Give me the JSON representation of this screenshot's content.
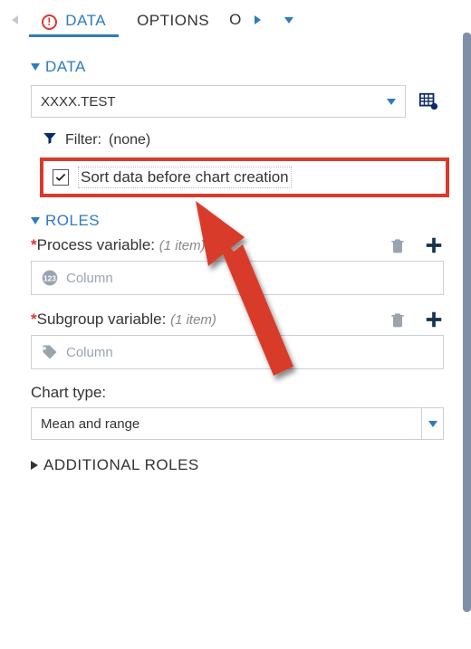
{
  "tabs": {
    "active": "DATA",
    "items": [
      "DATA",
      "OPTIONS"
    ],
    "overflow_letter": "O"
  },
  "data_section": {
    "title": "DATA",
    "source": "XXXX.TEST",
    "filter_label": "Filter:",
    "filter_value": "(none)",
    "sort_checkbox_label": "Sort data before chart creation",
    "sort_checked": true
  },
  "roles_section": {
    "title": "ROLES",
    "process_var": {
      "label": "Process variable:",
      "hint": "(1 item)",
      "placeholder": "Column"
    },
    "subgroup_var": {
      "label": "Subgroup variable:",
      "hint": "(1 item)",
      "placeholder": "Column"
    },
    "chart_type": {
      "label": "Chart type:",
      "value": "Mean and range"
    }
  },
  "additional_roles": {
    "title": "ADDITIONAL ROLES"
  }
}
